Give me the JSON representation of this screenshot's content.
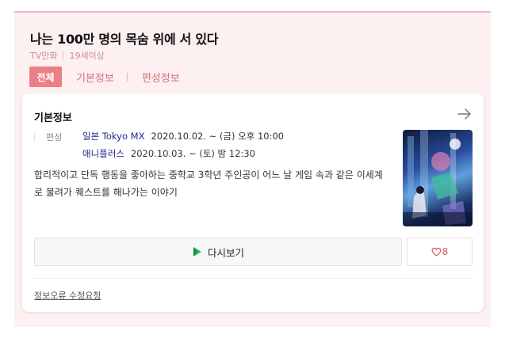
{
  "header": {
    "title": "나는 100만 명의 목숨 위에 서 있다",
    "meta": [
      "TV만화",
      "19세이상"
    ]
  },
  "tabs": [
    {
      "label": "전체",
      "active": true
    },
    {
      "label": "기본정보",
      "active": false
    },
    {
      "label": "편성정보",
      "active": false
    }
  ],
  "card": {
    "title": "기본정보",
    "schedule_label": "편성",
    "schedule": [
      {
        "channel": "일본 Tokyo MX",
        "datetime": "2020.10.02. ~ (금) 오후 10:00"
      },
      {
        "channel": "애니플러스",
        "datetime": "2020.10.03. ~ (토) 밤 12:30"
      }
    ],
    "synopsis": "합리적이고 단독 행동을 좋아하는 중학교 3학년 주인공이 어느 날 게임 속과 같은 이세계로 불려가 퀘스트를 해나가는 이야기",
    "rewatch_label": "다시보기",
    "like_count": "8",
    "report_link": "정보오류 수정요청"
  },
  "colors": {
    "accent": "#ea7f86",
    "panel_bg": "#fcf0f1",
    "channel_text": "#1f2b8a",
    "play_green": "#19c15a"
  },
  "icons": [
    "arrow-right-icon",
    "play-icon",
    "heart-icon"
  ]
}
